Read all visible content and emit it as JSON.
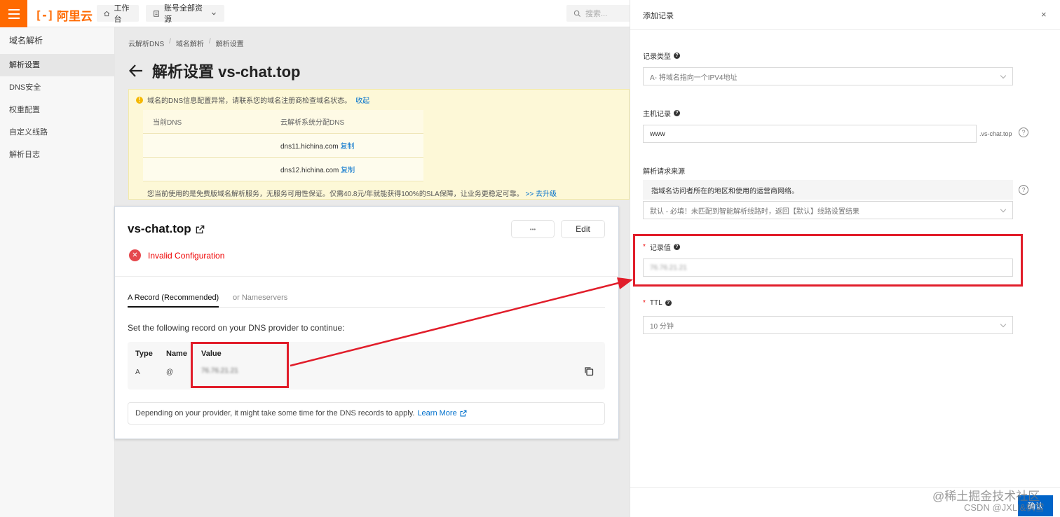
{
  "topbar": {
    "logo_text": "阿里云",
    "workbench": "工作台",
    "account_resources": "账号全部资源",
    "search_placeholder": "搜索..."
  },
  "sidebar": {
    "title": "域名解析",
    "items": [
      {
        "label": "解析设置",
        "active": true
      },
      {
        "label": "DNS安全",
        "active": false
      },
      {
        "label": "权重配置",
        "active": false
      },
      {
        "label": "自定义线路",
        "active": false
      },
      {
        "label": "解析日志",
        "active": false
      }
    ]
  },
  "main": {
    "breadcrumb": [
      "云解析DNS",
      "域名解析",
      "解析设置"
    ],
    "title": "解析设置 vs-chat.top",
    "alert": {
      "text": "域名的DNS信息配置异常，请联系您的域名注册商检查域名状态。",
      "collapse_link": "收起",
      "table_headers": [
        "当前DNS",
        "云解析系统分配DNS"
      ],
      "rows": [
        {
          "current": "",
          "assigned": "dns11.hichina.com",
          "action": "复制"
        },
        {
          "current": "",
          "assigned": "dns12.hichina.com",
          "action": "复制"
        }
      ],
      "upgrade_text": "您当前使用的是免费版域名解析服务，无服务可用性保证。仅需40.8元/年就能获得100%的SLA保障，让业务更稳定可靠。",
      "upgrade_link": ">> 去升级"
    }
  },
  "card": {
    "domain": "vs-chat.top",
    "more_button": "•••",
    "edit_button": "Edit",
    "status": "Invalid Configuration",
    "tabs": [
      "A Record (Recommended)",
      "or Nameservers"
    ],
    "instruction": "Set the following record on your DNS provider to continue:",
    "record": {
      "headers": [
        "Type",
        "Name",
        "Value"
      ],
      "type": "A",
      "name": "@",
      "value": "76.76.21.21"
    },
    "note": "Depending on your provider, it might take some time for the DNS records to apply.",
    "learn_more": "Learn More"
  },
  "drawer": {
    "title": "添加记录",
    "close": "×",
    "record_type_label": "记录类型",
    "record_type_value": "A- 将域名指向一个IPV4地址",
    "host_label": "主机记录",
    "host_value": "www",
    "host_suffix": ".vs-chat.top",
    "source_label": "解析请求来源",
    "source_hint": "指域名访问者所在的地区和使用的运营商网络。",
    "source_value": "默认 - 必填！未匹配到智能解析线路时，返回【默认】线路设置结果",
    "value_label": "记录值",
    "value_placeholder": "76.76.21.21",
    "ttl_label": "TTL",
    "ttl_value": "10 分钟",
    "ok_button": "确认"
  },
  "watermark": {
    "line1": "@稀土掘金技术社区",
    "line2": "CSDN @JXLI&枫雪"
  },
  "colors": {
    "brand": "#ff6a00",
    "highlight": "#e11d2a",
    "link": "#0070cc",
    "primary": "#0064c8"
  }
}
